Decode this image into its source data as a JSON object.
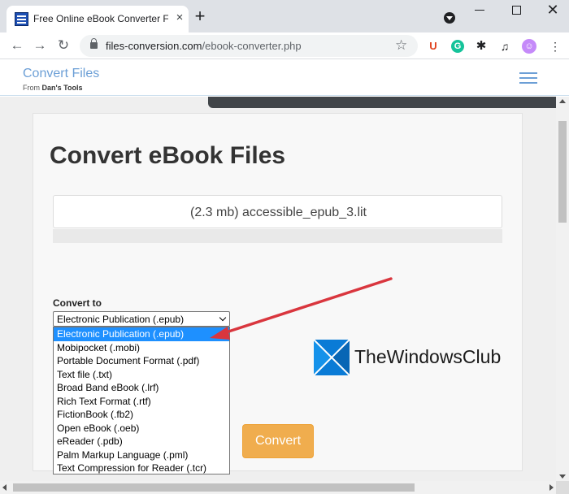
{
  "browser": {
    "tab_title": "Free Online eBook Converter File",
    "tab_favicon": "site-favicon",
    "new_tab": "+",
    "close_tab": "×",
    "url_domain": "files-conversion.com",
    "url_path": "/ebook-converter.php",
    "window_close": "✕"
  },
  "toolbar_icons": {
    "back": "←",
    "forward": "→",
    "reload": "↻",
    "star": "☆",
    "ext_u": "U",
    "ext_g": "G",
    "ext_puzzle": "✱",
    "ext_media": "♫",
    "ext_avatar": "☺",
    "menu": "⋮"
  },
  "site": {
    "brand": "Convert Files",
    "brand_sub_prefix": "From",
    "brand_sub_name": "Dan's Tools"
  },
  "main": {
    "title": "Convert eBook Files",
    "file_label": "(2.3 mb) accessible_epub_3.lit",
    "convert_to_label": "Convert to",
    "selected_format": "Electronic Publication (.epub)",
    "format_options": [
      "Electronic Publication (.epub)",
      "Mobipocket (.mobi)",
      "Portable Document Format (.pdf)",
      "Text file (.txt)",
      "Broad Band eBook (.lrf)",
      "Rich Text Format (.rtf)",
      "FictionBook (.fb2)",
      "Open eBook (.oeb)",
      "eReader (.pdb)",
      "Palm Markup Language (.pml)",
      "Text Compression for Reader (.tcr)"
    ],
    "convert_button": "Convert"
  },
  "watermark": {
    "text": "TheWindowsClub"
  },
  "colors": {
    "brand": "#6c9fd6",
    "button": "#f0ad4e",
    "selected_option": "#1e90ff",
    "arrow": "#d9363e"
  }
}
